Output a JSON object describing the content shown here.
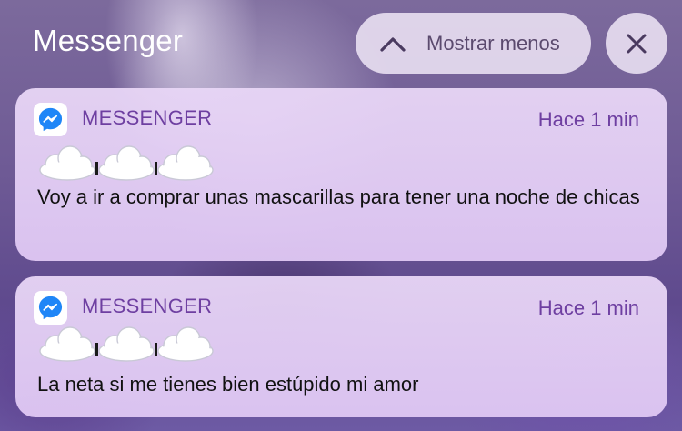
{
  "header": {
    "title": "Messenger",
    "show_less_label": "Mostrar menos"
  },
  "colors": {
    "accent": "#6e3fa1",
    "messenger_blue": "#1f86f7"
  },
  "notifications": [
    {
      "app_name": "MESSENGER",
      "time": "Hace 1 min",
      "sender": "",
      "message": "Voy a ir a comprar unas mascarillas para tener una noche de chicas"
    },
    {
      "app_name": "MESSENGER",
      "time": "Hace 1 min",
      "sender": "",
      "message": "La neta si me tienes bien estúpido mi amor"
    }
  ],
  "icons": [
    "messenger-app-icon",
    "chevron-up-icon",
    "close-icon",
    "cloud-sticker-icon"
  ]
}
